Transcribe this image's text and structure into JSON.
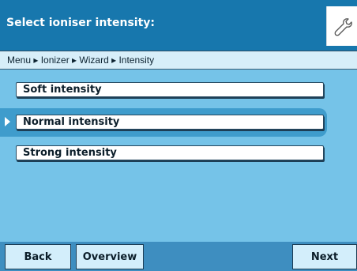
{
  "header": {
    "title": "Select ioniser intensity:",
    "settings_icon": "wrench-icon"
  },
  "breadcrumb": {
    "path": "Menu ▸ Ionizer ▸ Wizard ▸ Intensity"
  },
  "options": [
    {
      "label": "Soft intensity",
      "selected": false
    },
    {
      "label": "Normal intensity",
      "selected": true
    },
    {
      "label": "Strong intensity",
      "selected": false
    }
  ],
  "footer": {
    "back_label": "Back",
    "overview_label": "Overview",
    "next_label": "Next"
  },
  "colors": {
    "header_bg": "#1777ad",
    "content_bg": "#75c3e8",
    "selected_band": "#3f9ccc",
    "footer_bg": "#3e8ec0"
  }
}
